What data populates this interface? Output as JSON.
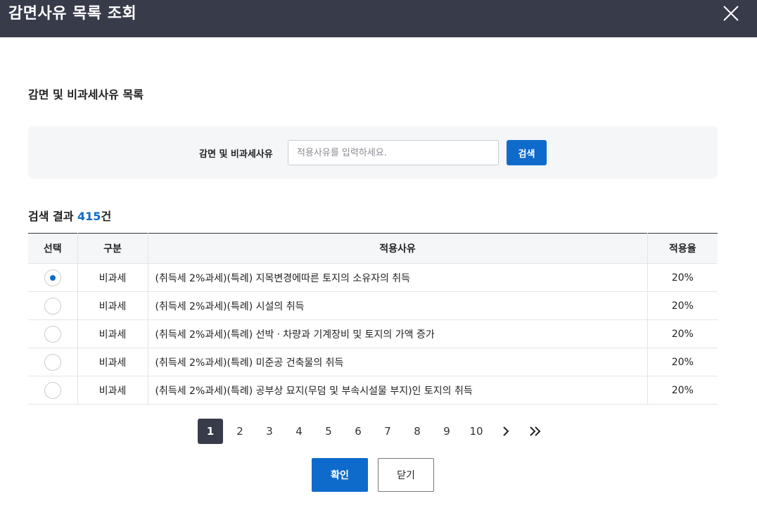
{
  "dialog": {
    "title": "감면사유 목록 조회",
    "close_icon": "close-icon"
  },
  "section": {
    "title": "감면 및 비과세사유 목록"
  },
  "search": {
    "label": "감면 및 비과세사유",
    "placeholder": "적용사유를 입력하세요.",
    "value": "",
    "button_label": "검색"
  },
  "results": {
    "prefix": "검색 결과 ",
    "count": "415",
    "suffix": "건"
  },
  "table": {
    "headers": [
      "선택",
      "구분",
      "적용사유",
      "적용율"
    ],
    "rows": [
      {
        "selected": true,
        "category": "비과세",
        "reason": "(취득세 2%과세)(특례) 지목변경에따른 토지의 소유자의 취득",
        "rate": "20%"
      },
      {
        "selected": false,
        "category": "비과세",
        "reason": "(취득세 2%과세)(특례) 시설의 취득",
        "rate": "20%"
      },
      {
        "selected": false,
        "category": "비과세",
        "reason": "(취득세 2%과세)(특례) 선박ㆍ차량과 기계장비 및 토지의 가액 증가",
        "rate": "20%"
      },
      {
        "selected": false,
        "category": "비과세",
        "reason": "(취득세 2%과세)(특례) 미준공 건축물의 취득",
        "rate": "20%"
      },
      {
        "selected": false,
        "category": "비과세",
        "reason": "(취득세 2%과세)(특례) 공부상 묘지(무덤 및 부속시설물 부지)인 토지의 취득",
        "rate": "20%"
      }
    ]
  },
  "pagination": {
    "pages": [
      "1",
      "2",
      "3",
      "4",
      "5",
      "6",
      "7",
      "8",
      "9",
      "10"
    ],
    "current": "1",
    "next_icon": "chevron-right-icon",
    "last_icon": "double-chevron-right-icon"
  },
  "footer": {
    "confirm_label": "확인",
    "close_label": "닫기"
  },
  "colors": {
    "header_bg": "#373b4a",
    "accent": "#0f6bcb",
    "panel_bg": "#f5f6f8"
  }
}
